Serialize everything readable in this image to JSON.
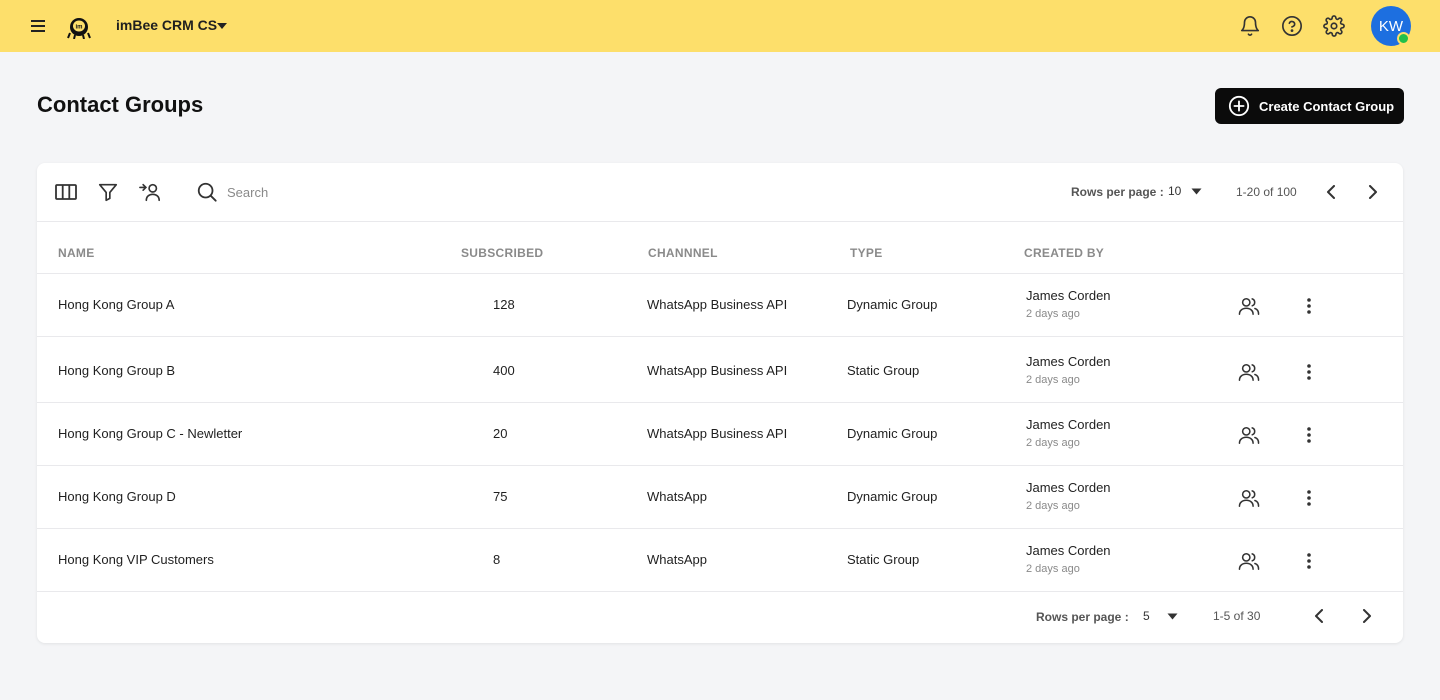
{
  "header": {
    "app_name": "imBee CRM CS",
    "avatar_initials": "KW",
    "brand_color": "#fddf6b",
    "avatar_color": "#1d6fe0",
    "status_color": "#20c04a"
  },
  "page": {
    "title": "Contact Groups",
    "create_button_label": "Create Contact Group"
  },
  "toolbar": {
    "search_placeholder": "Search",
    "rows_per_page_label": "Rows per page :",
    "rows_per_page_value": "10",
    "range_text": "1-20 of 100"
  },
  "columns": {
    "name": "NAME",
    "subscribed": "SUBSCRIBED",
    "channel": "CHANNNEL",
    "type": "TYPE",
    "created_by": "CREATED BY"
  },
  "rows": [
    {
      "name": "Hong Kong Group A",
      "subscribed": "128",
      "channel": "WhatsApp Business API",
      "type": "Dynamic Group",
      "creator": "James Corden",
      "created": "2 days ago"
    },
    {
      "name": "Hong Kong  Group B",
      "subscribed": "400",
      "channel": "WhatsApp Business API",
      "type": "Static Group",
      "creator": "James Corden",
      "created": "2 days ago"
    },
    {
      "name": "Hong Kong Group C - Newletter",
      "subscribed": "20",
      "channel": "WhatsApp Business API",
      "type": "Dynamic Group",
      "creator": "James Corden",
      "created": "2 days ago"
    },
    {
      "name": "Hong Kong Group D",
      "subscribed": "75",
      "channel": "WhatsApp",
      "type": "Dynamic Group",
      "creator": "James Corden",
      "created": "2 days ago"
    },
    {
      "name": "Hong Kong VIP Customers",
      "subscribed": "8",
      "channel": "WhatsApp",
      "type": "Static Group",
      "creator": "James Corden",
      "created": "2 days ago"
    }
  ],
  "footer": {
    "rows_per_page_label": "Rows per page :",
    "rows_per_page_value": "5",
    "range_text": "1-5 of 30"
  },
  "icons": [
    "menu-icon",
    "imbee-logo-icon",
    "caret-down-icon",
    "bell-icon",
    "help-icon",
    "gear-icon",
    "plus-circle-icon",
    "columns-icon",
    "filter-icon",
    "add-user-icon",
    "search-icon",
    "chevron-left-icon",
    "chevron-right-icon",
    "members-icon",
    "more-vertical-icon"
  ]
}
